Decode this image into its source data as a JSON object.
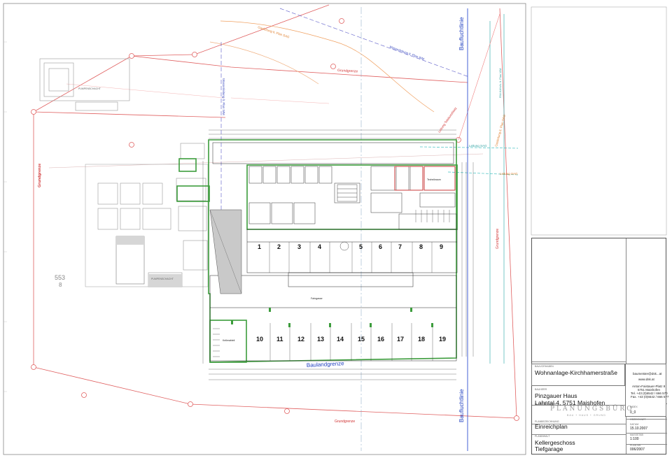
{
  "plan_labels": {
    "grundgrenze": "Grundgrenze",
    "baufluchtlinie": "Baufluchtlinie",
    "baulandgrenze": "Baulandgrenze",
    "wasserleitung": "Wasserleitung lt. Plan WM",
    "gasleitung": "Gasleitung lt. Plan SAG",
    "leitung_sag": "Leitung SAG",
    "leitung_telekom": "Leitung Telekom/Netz",
    "rw_kanal": "RW-KANAL lt. Plan WM",
    "parcel_number": "553",
    "parcel_sub": "8",
    "pumpenschacht": "PUMPENSCHACHT",
    "kellerabteil": "Kellerabteil",
    "fahrgasse": "Fahrgasse",
    "technikraum": "Technikraum"
  },
  "parking_top": [
    "1",
    "2",
    "3",
    "4",
    "5",
    "6",
    "7",
    "8",
    "9"
  ],
  "parking_bottom": [
    "10",
    "11",
    "12",
    "13",
    "14",
    "15",
    "16",
    "17",
    "18",
    "19"
  ],
  "title_block": {
    "project_caption": "BAUVORHABEN",
    "project": "Wohnanlage-Kirchhamerstraße",
    "owner_caption": "BAUHERR",
    "owner_name": "Pinzgauer Haus",
    "owner_address": "Lahntal 4, 5751 Maishofen",
    "email": "baumeister@dsk...at",
    "web": "www.dsk.at",
    "address_line1": "Anton-Faistauer-Platz 8",
    "address_line2": "5751 Maishofen",
    "tel": "Tel. +43 (0)6542 / 666 570",
    "fax": "Fax. +43 (0)6542 / 666 577",
    "planner_caption": "PLANVERFASSER",
    "logo": "PLANUNGSBÜRO",
    "logo_sub": "BAU + HAUS + GRUND",
    "plan_type_caption": "PLANBEZEICHNUNG",
    "plan_type": "Einreichplan",
    "content_caption": "PLANINHALT",
    "content_line1": "Kellergeschoss",
    "content_line2": "Tiefgarage",
    "index_caption": "INDEX",
    "index": "0_0",
    "date_caption": "DATUM",
    "date": "15.10.2007",
    "scale_caption": "MASSSTAB",
    "scale": "1:100",
    "plan_no_caption": "PLAN NR.",
    "plan_no": "006/2007",
    "gezeichnet_caption": "GEZEICHNET"
  }
}
